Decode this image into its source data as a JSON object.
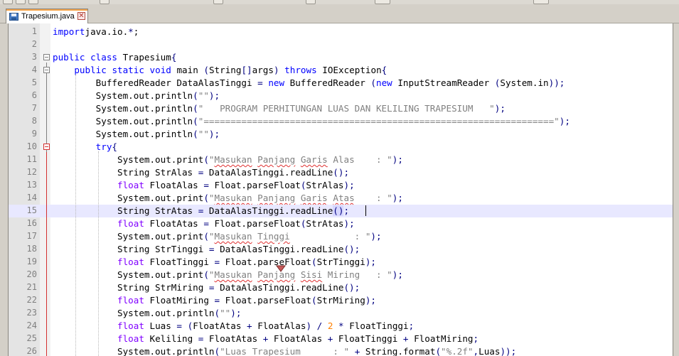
{
  "tab": {
    "title": "Trapesium.java",
    "close_glyph": "✕",
    "icon": "save-disk-icon"
  },
  "colors": {
    "keyword": "#0000ff",
    "type_keyword": "#8000ff",
    "string": "#808080",
    "number": "#ff8000",
    "operator": "#000080",
    "current_line": "#e8e8ff"
  },
  "current_line": 15,
  "lines": [
    {
      "n": "1",
      "tokens": [
        [
          "kw",
          "import"
        ],
        [
          "",
          "java.io."
        ],
        [
          "op",
          "*"
        ],
        [
          "",
          ";"
        ]
      ]
    },
    {
      "n": "2",
      "tokens": []
    },
    {
      "n": "3",
      "tokens": [
        [
          "kw",
          "public"
        ],
        [
          "",
          " "
        ],
        [
          "kw",
          "class"
        ],
        [
          "",
          " Trapesium"
        ],
        [
          "op",
          "{"
        ]
      ]
    },
    {
      "n": "4",
      "tokens": [
        [
          "",
          "    "
        ],
        [
          "kw",
          "public"
        ],
        [
          "",
          " "
        ],
        [
          "kw",
          "static"
        ],
        [
          "",
          " "
        ],
        [
          "kw",
          "void"
        ],
        [
          "",
          " main "
        ],
        [
          "op",
          "("
        ],
        [
          "",
          "String"
        ],
        [
          "op",
          "[]"
        ],
        [
          "",
          "args"
        ],
        [
          "op",
          ")"
        ],
        [
          "",
          " "
        ],
        [
          "kw",
          "throws"
        ],
        [
          "",
          " IOException"
        ],
        [
          "op",
          "{"
        ]
      ]
    },
    {
      "n": "5",
      "tokens": [
        [
          "",
          "        BufferedReader DataAlasTinggi "
        ],
        [
          "op",
          "="
        ],
        [
          "",
          " "
        ],
        [
          "kw",
          "new"
        ],
        [
          "",
          " BufferedReader "
        ],
        [
          "op",
          "("
        ],
        [
          "kw",
          "new"
        ],
        [
          "",
          " InputStreamReader "
        ],
        [
          "op",
          "("
        ],
        [
          "",
          "System.in"
        ],
        [
          "op",
          "));"
        ]
      ]
    },
    {
      "n": "6",
      "tokens": [
        [
          "",
          "        System.out.println"
        ],
        [
          "op",
          "("
        ],
        [
          "str",
          "\"\""
        ],
        [
          "op",
          ");"
        ]
      ]
    },
    {
      "n": "7",
      "tokens": [
        [
          "",
          "        System.out.println"
        ],
        [
          "op",
          "("
        ],
        [
          "str",
          "\"   PROGRAM PERHITUNGAN LUAS DAN KELILING TRAPESIUM   \""
        ],
        [
          "op",
          ");"
        ]
      ]
    },
    {
      "n": "8",
      "tokens": [
        [
          "",
          "        System.out.println"
        ],
        [
          "op",
          "("
        ],
        [
          "str",
          "\"=================================================================\""
        ],
        [
          "op",
          ");"
        ]
      ]
    },
    {
      "n": "9",
      "tokens": [
        [
          "",
          "        System.out.println"
        ],
        [
          "op",
          "("
        ],
        [
          "str",
          "\"\""
        ],
        [
          "op",
          ");"
        ]
      ]
    },
    {
      "n": "10",
      "tokens": [
        [
          "",
          "        "
        ],
        [
          "kw",
          "try"
        ],
        [
          "op",
          "{"
        ]
      ]
    },
    {
      "n": "11",
      "tokens": [
        [
          "",
          "            System.out.print"
        ],
        [
          "op",
          "("
        ],
        [
          "str",
          "\""
        ],
        [
          "sq",
          "Masukan"
        ],
        [
          "str",
          " "
        ],
        [
          "sq",
          "Panjang"
        ],
        [
          "str",
          " "
        ],
        [
          "sq",
          "Garis"
        ],
        [
          "str",
          " Alas    : \""
        ],
        [
          "op",
          ");"
        ]
      ]
    },
    {
      "n": "12",
      "tokens": [
        [
          "",
          "            String StrAlas "
        ],
        [
          "op",
          "="
        ],
        [
          "",
          " DataAlasTinggi.readLine"
        ],
        [
          "op",
          "();"
        ]
      ]
    },
    {
      "n": "13",
      "tokens": [
        [
          "",
          "            "
        ],
        [
          "kw2",
          "float"
        ],
        [
          "",
          " FloatAlas "
        ],
        [
          "op",
          "="
        ],
        [
          "",
          " Float.parseFloat"
        ],
        [
          "op",
          "("
        ],
        [
          "",
          "StrAlas"
        ],
        [
          "op",
          ");"
        ]
      ]
    },
    {
      "n": "14",
      "tokens": [
        [
          "",
          "            System.out.print"
        ],
        [
          "op",
          "("
        ],
        [
          "str",
          "\""
        ],
        [
          "sq",
          "Masukan"
        ],
        [
          "str",
          " "
        ],
        [
          "sq",
          "Panjang"
        ],
        [
          "str",
          " "
        ],
        [
          "sq",
          "Garis"
        ],
        [
          "str",
          " "
        ],
        [
          "sq",
          "Atas"
        ],
        [
          "str",
          "    : \""
        ],
        [
          "op",
          ");"
        ]
      ]
    },
    {
      "n": "15",
      "tokens": [
        [
          "",
          "            String StrAtas "
        ],
        [
          "op",
          "="
        ],
        [
          "",
          " DataAlasTinggi.readLine"
        ],
        [
          "hl",
          "()"
        ],
        [
          "op",
          ";"
        ]
      ]
    },
    {
      "n": "16",
      "tokens": [
        [
          "",
          "            "
        ],
        [
          "kw2",
          "float"
        ],
        [
          "",
          " FloatAtas "
        ],
        [
          "op",
          "="
        ],
        [
          "",
          " Float.parseFloat"
        ],
        [
          "op",
          "("
        ],
        [
          "",
          "StrAtas"
        ],
        [
          "op",
          ");"
        ]
      ]
    },
    {
      "n": "17",
      "tokens": [
        [
          "",
          "            System.out.print"
        ],
        [
          "op",
          "("
        ],
        [
          "str",
          "\""
        ],
        [
          "sq",
          "Masukan"
        ],
        [
          "str",
          " "
        ],
        [
          "sq",
          "Tinggi"
        ],
        [
          "str",
          "            : \""
        ],
        [
          "op",
          ");"
        ]
      ]
    },
    {
      "n": "18",
      "tokens": [
        [
          "",
          "            String StrTinggi "
        ],
        [
          "op",
          "="
        ],
        [
          "",
          " DataAlasTinggi.readLine"
        ],
        [
          "op",
          "();"
        ]
      ]
    },
    {
      "n": "19",
      "tokens": [
        [
          "",
          "            "
        ],
        [
          "kw2",
          "float"
        ],
        [
          "",
          " FloatTinggi "
        ],
        [
          "op",
          "="
        ],
        [
          "",
          " Float.parseFloat"
        ],
        [
          "op",
          "("
        ],
        [
          "",
          "StrTinggi"
        ],
        [
          "op",
          ");"
        ]
      ]
    },
    {
      "n": "20",
      "tokens": [
        [
          "",
          "            System.out.print"
        ],
        [
          "op",
          "("
        ],
        [
          "str",
          "\""
        ],
        [
          "sq",
          "Masukan"
        ],
        [
          "str",
          " "
        ],
        [
          "sq",
          "Panjang"
        ],
        [
          "str",
          " "
        ],
        [
          "sq",
          "Sisi"
        ],
        [
          "str",
          " Miring   : \""
        ],
        [
          "op",
          ");"
        ]
      ]
    },
    {
      "n": "21",
      "tokens": [
        [
          "",
          "            String StrMiring "
        ],
        [
          "op",
          "="
        ],
        [
          "",
          " DataAlasTinggi.readLine"
        ],
        [
          "op",
          "();"
        ]
      ]
    },
    {
      "n": "22",
      "tokens": [
        [
          "",
          "            "
        ],
        [
          "kw2",
          "float"
        ],
        [
          "",
          " FloatMiring "
        ],
        [
          "op",
          "="
        ],
        [
          "",
          " Float.parseFloat"
        ],
        [
          "op",
          "("
        ],
        [
          "",
          "StrMiring"
        ],
        [
          "op",
          ");"
        ]
      ]
    },
    {
      "n": "23",
      "tokens": [
        [
          "",
          "            System.out.println"
        ],
        [
          "op",
          "("
        ],
        [
          "str",
          "\"\""
        ],
        [
          "op",
          ");"
        ]
      ]
    },
    {
      "n": "24",
      "tokens": [
        [
          "",
          "            "
        ],
        [
          "kw2",
          "float"
        ],
        [
          "",
          " Luas "
        ],
        [
          "op",
          "="
        ],
        [
          "",
          " "
        ],
        [
          "op",
          "("
        ],
        [
          "",
          "FloatAtas "
        ],
        [
          "op",
          "+"
        ],
        [
          "",
          " FloatAlas"
        ],
        [
          "op",
          ")"
        ],
        [
          "",
          " "
        ],
        [
          "op",
          "/"
        ],
        [
          "",
          " "
        ],
        [
          "num",
          "2"
        ],
        [
          "",
          " "
        ],
        [
          "op",
          "*"
        ],
        [
          "",
          " FloatTinggi"
        ],
        [
          "op",
          ";"
        ]
      ]
    },
    {
      "n": "25",
      "tokens": [
        [
          "",
          "            "
        ],
        [
          "kw2",
          "float"
        ],
        [
          "",
          " Keliling "
        ],
        [
          "op",
          "="
        ],
        [
          "",
          " FloatAtas "
        ],
        [
          "op",
          "+"
        ],
        [
          "",
          " FloatAlas "
        ],
        [
          "op",
          "+"
        ],
        [
          "",
          " FloatTinggi "
        ],
        [
          "op",
          "+"
        ],
        [
          "",
          " FloatMiring"
        ],
        [
          "op",
          ";"
        ]
      ]
    },
    {
      "n": "26",
      "tokens": [
        [
          "",
          "            System.out.println"
        ],
        [
          "op",
          "("
        ],
        [
          "str",
          "\""
        ],
        [
          "sq",
          "Luas"
        ],
        [
          "str",
          " "
        ],
        [
          "sq",
          "Trapesium"
        ],
        [
          "str",
          "      : \""
        ],
        [
          "",
          " "
        ],
        [
          "op",
          "+"
        ],
        [
          "",
          " String.format"
        ],
        [
          "op",
          "("
        ],
        [
          "str",
          "\"%.2f\""
        ],
        [
          "op",
          ","
        ],
        [
          "",
          "Luas"
        ],
        [
          "op",
          "));"
        ]
      ]
    }
  ]
}
